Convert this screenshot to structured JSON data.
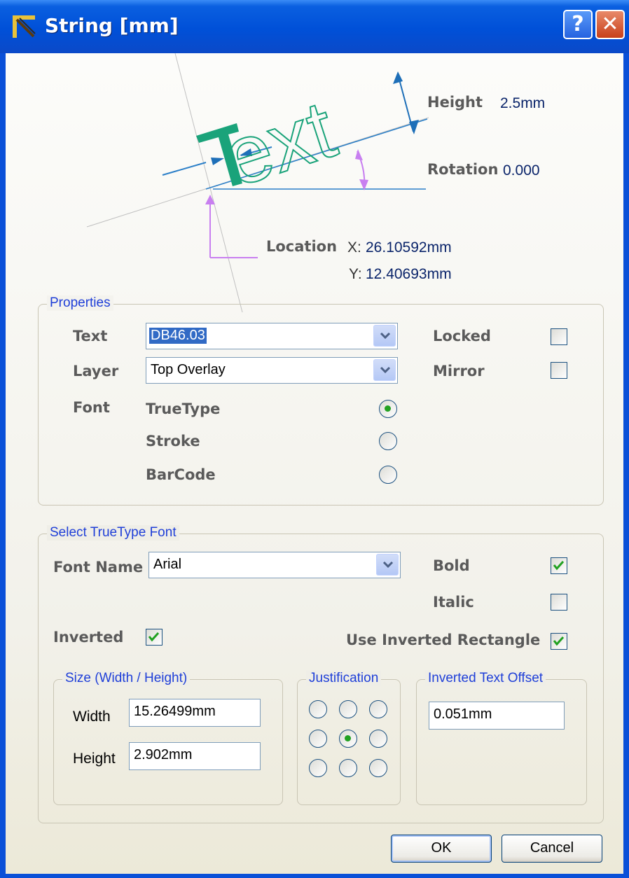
{
  "window": {
    "title": "String [mm]",
    "help_label": "?",
    "close_label": "✕"
  },
  "diagram": {
    "sample_text": "Text",
    "height_label": "Height",
    "height_value": "2.5mm",
    "rotation_label": "Rotation",
    "rotation_value": "0.000",
    "location_label": "Location",
    "x_label": "X:",
    "x_value": "26.10592mm",
    "y_label": "Y:",
    "y_value": "12.40693mm"
  },
  "properties": {
    "title": "Properties",
    "text_label": "Text",
    "text_value": "DB46.03",
    "layer_label": "Layer",
    "layer_value": "Top Overlay",
    "font_label": "Font",
    "font_options": [
      {
        "label": "TrueType",
        "selected": true
      },
      {
        "label": "Stroke",
        "selected": false
      },
      {
        "label": "BarCode",
        "selected": false
      }
    ],
    "locked_label": "Locked",
    "locked": false,
    "mirror_label": "Mirror",
    "mirror": false
  },
  "truetype": {
    "title": "Select TrueType Font",
    "font_name_label": "Font Name",
    "font_name_value": "Arial",
    "bold_label": "Bold",
    "bold": true,
    "italic_label": "Italic",
    "italic": false,
    "inverted_label": "Inverted",
    "inverted": true,
    "use_inverted_rect_label": "Use Inverted Rectangle",
    "use_inverted_rect": true,
    "size": {
      "title": "Size (Width / Height)",
      "width_label": "Width",
      "width_value": "15.26499mm",
      "height_label": "Height",
      "height_value": "2.902mm"
    },
    "justification": {
      "title": "Justification",
      "selected_index": 4
    },
    "offset": {
      "title": "Inverted Text Offset",
      "value": "0.051mm"
    }
  },
  "buttons": {
    "ok": "OK",
    "cancel": "Cancel"
  },
  "colors": {
    "title_bar": "#0050d8",
    "group_title": "#1f3fd8",
    "value_text": "#0a246a",
    "radio_dot": "#21a121",
    "check_mark": "#21a121",
    "diagram_text": "#1aa37a",
    "dimension_arrow": "#1e6fb8",
    "rotation_arc": "#c87ff0"
  }
}
